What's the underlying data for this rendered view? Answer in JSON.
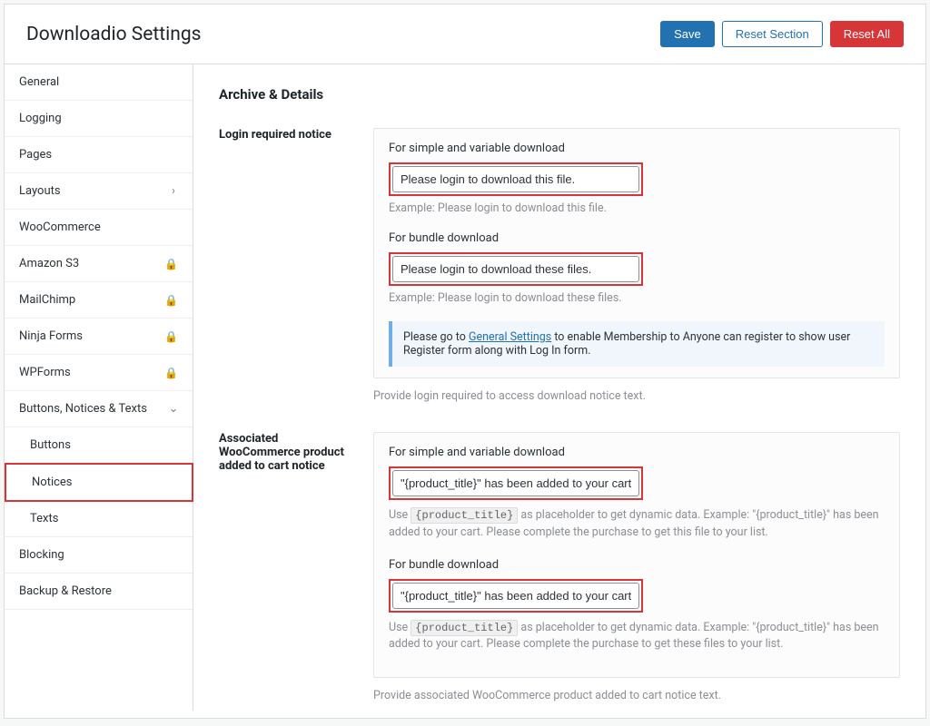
{
  "header": {
    "title": "Downloadio Settings",
    "save": "Save",
    "reset_section": "Reset Section",
    "reset_all": "Reset All"
  },
  "sidebar": {
    "general": "General",
    "logging": "Logging",
    "pages": "Pages",
    "layouts": "Layouts",
    "woocommerce": "WooCommerce",
    "amazon_s3": "Amazon S3",
    "mailchimp": "MailChimp",
    "ninja_forms": "Ninja Forms",
    "wpforms": "WPForms",
    "buttons_notices_texts": "Buttons, Notices & Texts",
    "buttons": "Buttons",
    "notices": "Notices",
    "texts": "Texts",
    "blocking": "Blocking",
    "backup_restore": "Backup & Restore"
  },
  "main": {
    "section_title": "Archive & Details",
    "login_notice": {
      "label": "Login required notice",
      "simple_label": "For simple and variable download",
      "simple_value": "Please login to download this file.",
      "simple_example": "Example: Please login to download this file.",
      "bundle_label": "For bundle download",
      "bundle_value": "Please login to download these files.",
      "bundle_example": "Example: Please login to download these files.",
      "help_pre": "Please go to ",
      "help_link": "General Settings",
      "help_post": " to enable Membership to Anyone can register to show user Register form along with Log In form.",
      "below": "Provide login required to access download notice text."
    },
    "cart_notice": {
      "label": "Associated WooCommerce product added to cart notice",
      "simple_label": "For simple and variable download",
      "simple_value": "\"{product_title}\" has been added to your cart. Please complete the purchase to get this file to your list.",
      "simple_use_pre": "Use ",
      "simple_use_code": "{product_title}",
      "simple_use_post": " as placeholder to get dynamic data. Example: \"{product_title}\" has been added to your cart. Please complete the purchase to get this file to your list.",
      "bundle_label": "For bundle download",
      "bundle_value": "\"{product_title}\" has been added to your cart. Please complete the purchase to get these files to your list.",
      "bundle_use_pre": "Use ",
      "bundle_use_code": "{product_title}",
      "bundle_use_post": " as placeholder to get dynamic data. Example: \"{product_title}\" has been added to your cart. Please complete the purchase to get these files to your list.",
      "below": "Provide associated WooCommerce product added to cart notice text."
    }
  }
}
